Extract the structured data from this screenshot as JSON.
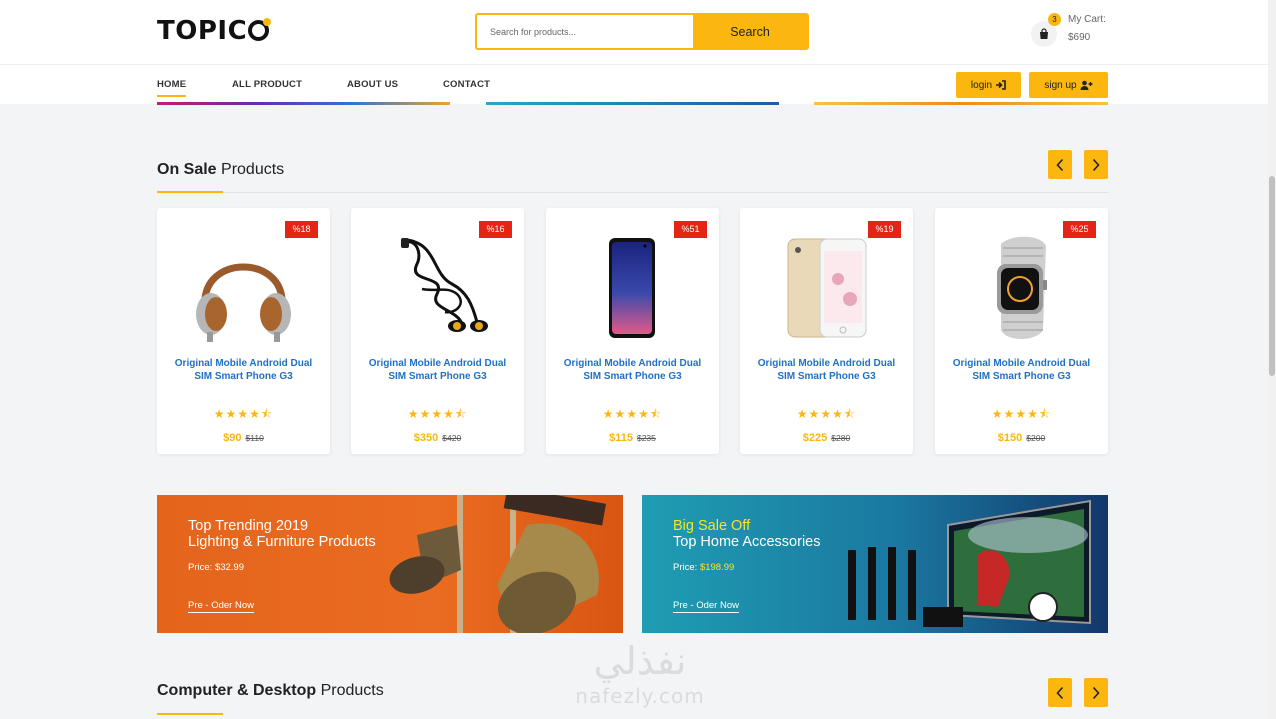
{
  "header": {
    "logo": "TOPIC",
    "search_placeholder": "Search for products...",
    "search_button": "Search",
    "cart_count": "3",
    "cart_label": "My Cart:",
    "cart_amount": "$690"
  },
  "nav": {
    "items": [
      "HOME",
      "ALL PRODUCT",
      "ABOUT US",
      "CONTACT"
    ],
    "login": "login",
    "signup": "sign up"
  },
  "on_sale": {
    "title_bold": "On Sale",
    "title_rest": " Products",
    "products": [
      {
        "badge": "%18",
        "name": "Original Mobile Android Dual SIM Smart Phone G3",
        "price": "$90",
        "old_price": "$110",
        "rating": 4.5,
        "image_icon": "headphones-icon"
      },
      {
        "badge": "%16",
        "name": "Original Mobile Android Dual SIM Smart Phone G3",
        "price": "$350",
        "old_price": "$420",
        "rating": 4.5,
        "image_icon": "earphones-icon"
      },
      {
        "badge": "%51",
        "name": "Original Mobile Android Dual SIM Smart Phone G3",
        "price": "$115",
        "old_price": "$235",
        "rating": 4.5,
        "image_icon": "smartphone-icon"
      },
      {
        "badge": "%19",
        "name": "Original Mobile Android Dual SIM Smart Phone G3",
        "price": "$225",
        "old_price": "$280",
        "rating": 4.5,
        "image_icon": "iphone-icon"
      },
      {
        "badge": "%25",
        "name": "Original Mobile Android Dual SIM Smart Phone G3",
        "price": "$150",
        "old_price": "$200",
        "rating": 4.5,
        "image_icon": "smartwatch-icon"
      }
    ]
  },
  "banners": [
    {
      "line1": "Top Trending 2019",
      "line2": "Lighting & Furniture Products",
      "price_label": "Price: ",
      "price": "$32.99",
      "cta": "Pre - Oder Now"
    },
    {
      "line1": "Big Sale Off",
      "line2": "Top Home Accessories",
      "price_label": "Price: ",
      "price": "$198.99",
      "cta": "Pre - Oder Now"
    }
  ],
  "computer_section": {
    "title_bold": "Computer & Desktop",
    "title_rest": " Products"
  },
  "watermark": {
    "arabic": "نفذلي",
    "latin": "nafezly.com"
  },
  "colors": {
    "accent": "#fbb710",
    "badge": "#e32417",
    "link": "#2170c8",
    "banner1": "#e4641c",
    "banner2": "#1d8ba6"
  }
}
